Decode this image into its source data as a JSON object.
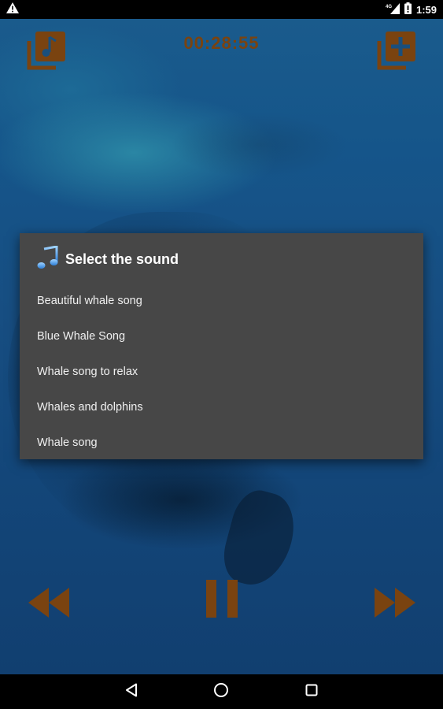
{
  "status_bar": {
    "time": "1:59",
    "network": "4G",
    "icons": [
      "warning-icon",
      "signal-icon",
      "battery-icon"
    ]
  },
  "player": {
    "timer": "00:28:55",
    "left_button_icon": "music-library-icon",
    "right_button_icon": "add-to-playlist-icon",
    "controls": [
      "rewind-icon",
      "pause-icon",
      "fast-forward-icon"
    ],
    "accent_color": "#7a4310"
  },
  "dialog": {
    "icon": "music-note-icon",
    "title": "Select the sound",
    "items": [
      {
        "label": "Beautiful whale song"
      },
      {
        "label": "Blue Whale Song"
      },
      {
        "label": "Whale song to relax"
      },
      {
        "label": "Whales and dolphins"
      },
      {
        "label": "Whale song"
      }
    ]
  },
  "nav_bar": {
    "buttons": [
      "back-icon",
      "home-icon",
      "recents-icon"
    ]
  }
}
